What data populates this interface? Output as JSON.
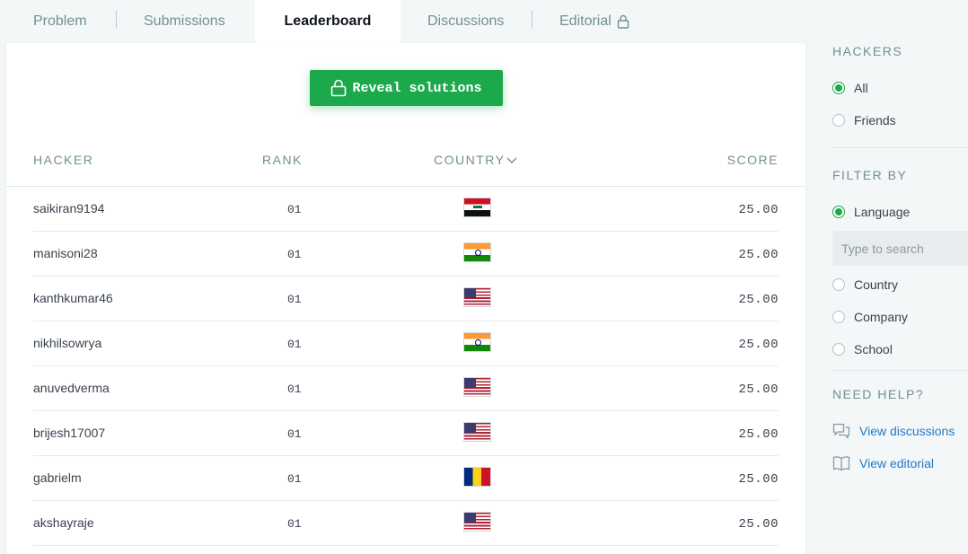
{
  "tabs": {
    "problem": "Problem",
    "submissions": "Submissions",
    "leaderboard": "Leaderboard",
    "discussions": "Discussions",
    "editorial": "Editorial"
  },
  "reveal_button": {
    "label": "Reveal solutions"
  },
  "table": {
    "headers": {
      "hacker": "HACKER",
      "rank": "RANK",
      "country": "COUNTRY",
      "score": "SCORE"
    },
    "rows": [
      {
        "hacker": "saikiran9194",
        "rank": "01",
        "country_flag": "iraq-flag-icon",
        "score": "25.00"
      },
      {
        "hacker": "manisoni28",
        "rank": "01",
        "country_flag": "india-flag-icon",
        "score": "25.00"
      },
      {
        "hacker": "kanthkumar46",
        "rank": "01",
        "country_flag": "usa-flag-icon",
        "score": "25.00"
      },
      {
        "hacker": "nikhilsowrya",
        "rank": "01",
        "country_flag": "india-flag-icon",
        "score": "25.00"
      },
      {
        "hacker": "anuvedverma",
        "rank": "01",
        "country_flag": "usa-flag-icon",
        "score": "25.00"
      },
      {
        "hacker": "brijesh17007",
        "rank": "01",
        "country_flag": "usa-flag-icon",
        "score": "25.00"
      },
      {
        "hacker": "gabrielm",
        "rank": "01",
        "country_flag": "romania-flag-icon",
        "score": "25.00"
      },
      {
        "hacker": "akshayraje",
        "rank": "01",
        "country_flag": "usa-flag-icon",
        "score": "25.00"
      }
    ]
  },
  "sidebar": {
    "hackers_title": "HACKERS",
    "hackers_options": [
      {
        "label": "All",
        "selected": true
      },
      {
        "label": "Friends",
        "selected": false
      }
    ],
    "filter_title": "FILTER BY",
    "filter_options": [
      {
        "label": "Language",
        "selected": true
      },
      {
        "label": "Country",
        "selected": false
      },
      {
        "label": "Company",
        "selected": false
      },
      {
        "label": "School",
        "selected": false
      }
    ],
    "search_placeholder": "Type to search",
    "help_title": "NEED HELP?",
    "help_links": [
      {
        "label": "View discussions",
        "icon": "discussions-icon"
      },
      {
        "label": "View editorial",
        "icon": "book-icon"
      }
    ]
  },
  "colors": {
    "accent_green": "#1ba94c",
    "link_blue": "#1f7ac9"
  }
}
